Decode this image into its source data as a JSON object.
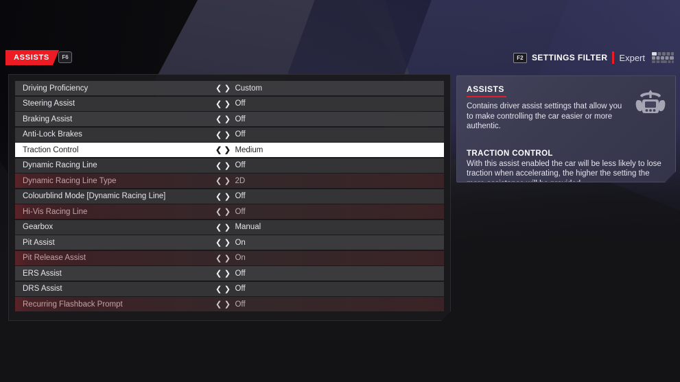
{
  "topbar": {
    "tab_label": "ASSISTS",
    "tab_key": "F6",
    "filter_key": "F2",
    "filter_label": "SETTINGS FILTER",
    "filter_value": "Expert",
    "keyboard_icon": "keyboard-icon",
    "accent_red": "#ed1c24"
  },
  "settings": {
    "rows": [
      {
        "name": "Driving Proficiency",
        "value": "Custom",
        "state": "normal"
      },
      {
        "name": "Steering Assist",
        "value": "Off",
        "state": "normal"
      },
      {
        "name": "Braking Assist",
        "value": "Off",
        "state": "normal"
      },
      {
        "name": "Anti-Lock Brakes",
        "value": "Off",
        "state": "normal"
      },
      {
        "name": "Traction Control",
        "value": "Medium",
        "state": "selected"
      },
      {
        "name": "Dynamic Racing Line",
        "value": "Off",
        "state": "normal"
      },
      {
        "name": "Dynamic Racing Line Type",
        "value": "2D",
        "state": "disabled"
      },
      {
        "name": "Colourblind Mode [Dynamic Racing Line]",
        "value": "Off",
        "state": "normal"
      },
      {
        "name": "Hi-Vis Racing Line",
        "value": "Off",
        "state": "disabled"
      },
      {
        "name": "Gearbox",
        "value": "Manual",
        "state": "normal"
      },
      {
        "name": "Pit Assist",
        "value": "On",
        "state": "normal"
      },
      {
        "name": "Pit Release Assist",
        "value": "On",
        "state": "disabled"
      },
      {
        "name": "ERS Assist",
        "value": "Off",
        "state": "normal"
      },
      {
        "name": "DRS Assist",
        "value": "Off",
        "state": "normal"
      },
      {
        "name": "Recurring Flashback Prompt",
        "value": "Off",
        "state": "disabled"
      }
    ],
    "left_arrow": "❮",
    "right_arrow": "❯"
  },
  "info": {
    "title": "ASSISTS",
    "description": "Contains driver assist settings that allow you to make controlling the car easier or more authentic.",
    "sub_title": "TRACTION CONTROL",
    "sub_description": "With this assist enabled the car will be less likely to lose traction when accelerating, the higher the setting the more assistance will be provided.",
    "icon": "steering-wheel-icon",
    "underline_color": "#e02028"
  }
}
